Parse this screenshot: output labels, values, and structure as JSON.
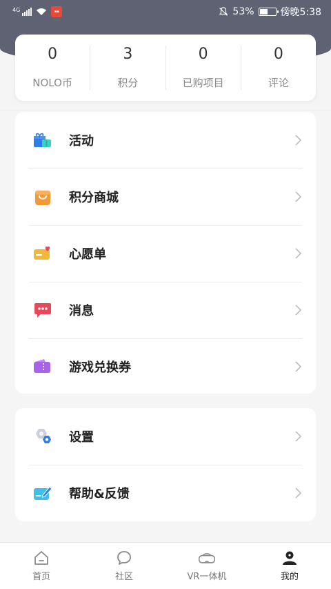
{
  "status_bar": {
    "network": "4G",
    "battery_percent": "53%",
    "battery_level": 0.53,
    "time": "傍晚5:38"
  },
  "stats": [
    {
      "value": "0",
      "label": "NOLO币"
    },
    {
      "value": "3",
      "label": "积分"
    },
    {
      "value": "0",
      "label": "已购项目"
    },
    {
      "value": "0",
      "label": "评论"
    }
  ],
  "menu_main": [
    {
      "label": "活动",
      "icon": "gift-icon"
    },
    {
      "label": "积分商城",
      "icon": "shopping-bag-icon"
    },
    {
      "label": "心愿单",
      "icon": "wishlist-card-icon"
    },
    {
      "label": "消息",
      "icon": "message-bubble-icon"
    },
    {
      "label": "游戏兑换券",
      "icon": "ticket-icon"
    }
  ],
  "menu_secondary": [
    {
      "label": "设置",
      "icon": "settings-gear-icon"
    },
    {
      "label": "帮助&反馈",
      "icon": "feedback-edit-icon"
    }
  ],
  "tabs": [
    {
      "label": "首页",
      "icon": "home-icon"
    },
    {
      "label": "社区",
      "icon": "chat-icon"
    },
    {
      "label": "VR一体机",
      "icon": "vr-headset-icon"
    },
    {
      "label": "我的",
      "icon": "profile-icon"
    }
  ],
  "active_tab": "我的",
  "colors": {
    "header": "#5e6273",
    "accent_orange": "#f29a38",
    "accent_red": "#e8485a",
    "accent_purple": "#a764e8",
    "accent_blue": "#2f9df0"
  }
}
